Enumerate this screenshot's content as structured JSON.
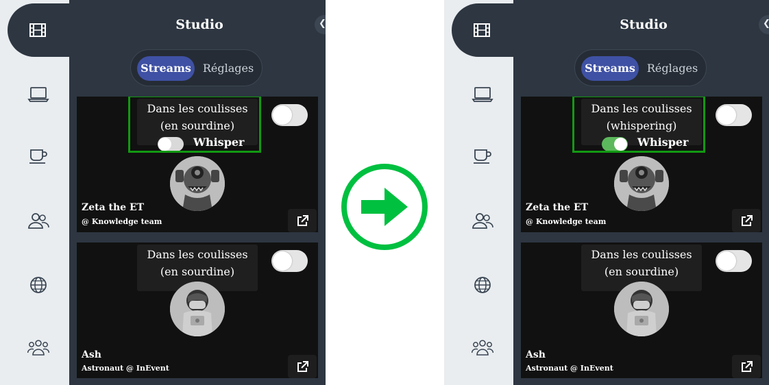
{
  "colors": {
    "accent": "#3f51a4",
    "highlight": "#129912",
    "arrow": "#00c040",
    "toggle_on": "#5cb85c"
  },
  "arrow_icon": "right-arrow-icon",
  "before": {
    "header": {
      "title": "Studio"
    },
    "tabs": {
      "streams": "Streams",
      "settings": "Réglages"
    },
    "cards": [
      {
        "status_label": "Dans les coulisses (en sourdine)",
        "whisper_label": "Whisper",
        "whisper_on": false,
        "name": "Zeta the ET",
        "subtitle": "@ Knowledge team",
        "avatar": "alien-avatar"
      },
      {
        "status_label": "Dans les coulisses (en sourdine)",
        "name": "Ash",
        "subtitle": "Astronaut @ InEvent",
        "avatar": "astronaut-avatar"
      }
    ]
  },
  "after": {
    "header": {
      "title": "Studio"
    },
    "tabs": {
      "streams": "Streams",
      "settings": "Réglages"
    },
    "cards": [
      {
        "status_label": "Dans les coulisses (whispering)",
        "whisper_label": "Whisper",
        "whisper_on": true,
        "name": "Zeta the ET",
        "subtitle": "@ Knowledge team",
        "avatar": "alien-avatar"
      },
      {
        "status_label": "Dans les coulisses (en sourdine)",
        "name": "Ash",
        "subtitle": "Astronaut @ InEvent",
        "avatar": "astronaut-avatar"
      }
    ]
  }
}
